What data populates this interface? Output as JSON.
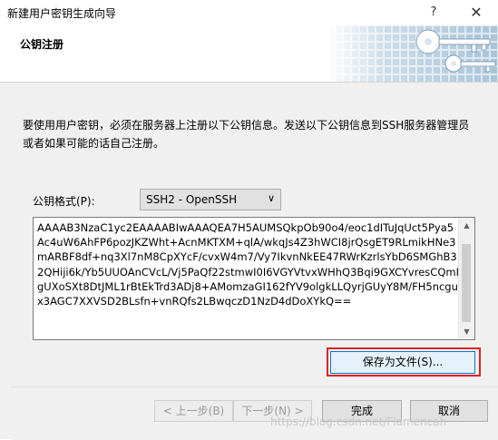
{
  "window": {
    "title": "新建用户密钥生成向导",
    "help_glyph": "?",
    "close_glyph": "✕"
  },
  "header": {
    "title": "公钥注册"
  },
  "main": {
    "description": "要使用用户密钥，必须在服务器上注册以下公钥信息。发送以下公钥信息到SSH服务器管理员或者如果可能的话自己注册。",
    "format_label": "公钥格式(P):",
    "format_value": "SSH2 - OpenSSH",
    "public_key": "AAAAB3NzaC1yc2EAAAABIwAAAQEA7H5AUMSQkpOb90o4/eoc1dITuJqUct5Pya5Ac4uW6AhFP6pozJKZWht+AcnMKTXM+qlA/wkqJs4Z3hWCI8jrQsgET9RLmikHNe3mARBF8df+nq3Xl7nM8CpXYcF/cvxW4m7/Vy7IkvnNkEE47RWrKzrlsYbD6SMGhB32QHiji6k/Yb5UUOAnCVcL/Vj5PaQf22stmwI0I6VGYVtvxWHhQ3Bqi9GXCYvresCQmIgUXoSXt8DtJML1rBtEkTrd3ADj8+AMomzaGI162fYV9olgkLLQyrjGUyY8M/FH5ncgux3AGC7XXVSD2BLsfn+vnRQfs2LBwqczD1NzD4dDoXYkQ==",
    "save_button": "保存为文件(S)..."
  },
  "footer": {
    "back": "< 上一步(B)",
    "next": "下一步(N) >",
    "finish": "完成",
    "cancel": "取消"
  },
  "watermark": "https://blog.csdn.net/Flamencah",
  "colors": {
    "dialog_bg": "#f0f0f0",
    "highlight": "#e02020",
    "focus": "#0078d7"
  }
}
